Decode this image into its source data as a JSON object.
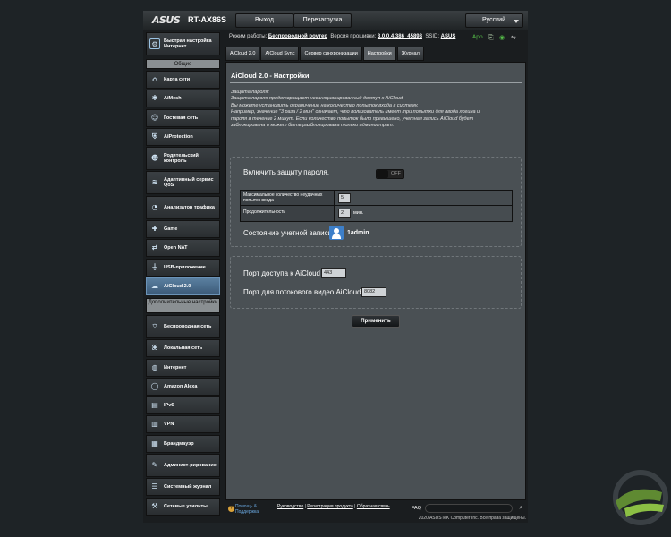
{
  "header": {
    "brand": "ASUS",
    "model": "RT-AX86S",
    "logout_label": "Выход",
    "reboot_label": "Перезагрузка",
    "language": "Русский"
  },
  "status": {
    "mode_label": "Режим работы:",
    "mode_value": "Беспроводной роутер",
    "firmware_label": "Версия прошивки:",
    "firmware_value": "3.0.0.4.386_45898",
    "ssid_label": "SSID:",
    "ssid_value": "ASUS",
    "app_label": "App"
  },
  "sidebar": {
    "quick_setup": "Быстрая настройка Интернет",
    "general_header": "Общие",
    "general_items": [
      {
        "label": "Карта сети",
        "icon": "network-map-icon"
      },
      {
        "label": "AiMesh",
        "icon": "aimesh-icon"
      },
      {
        "label": "Гостевая сеть",
        "icon": "guest-network-icon"
      },
      {
        "label": "AiProtection",
        "icon": "shield-icon"
      },
      {
        "label": "Родительский контроль",
        "icon": "parental-control-icon"
      },
      {
        "label": "Адаптивный сервис QoS",
        "icon": "qos-icon"
      },
      {
        "label": "Анализатор трафика",
        "icon": "traffic-analyzer-icon"
      },
      {
        "label": "Game",
        "icon": "gamepad-icon"
      },
      {
        "label": "Open NAT",
        "icon": "open-nat-icon"
      },
      {
        "label": "USB-приложение",
        "icon": "usb-icon"
      },
      {
        "label": "AiCloud 2.0",
        "icon": "cloud-icon"
      }
    ],
    "advanced_header": "Дополнительные настройки",
    "advanced_items": [
      {
        "label": "Беспроводная сеть",
        "icon": "wireless-icon"
      },
      {
        "label": "Локальная сеть",
        "icon": "lan-icon"
      },
      {
        "label": "Интернет",
        "icon": "globe-icon"
      },
      {
        "label": "Amazon Alexa",
        "icon": "alexa-icon"
      },
      {
        "label": "IPv6",
        "icon": "ipv6-icon"
      },
      {
        "label": "VPN",
        "icon": "vpn-icon"
      },
      {
        "label": "Брандмауэр",
        "icon": "firewall-icon"
      },
      {
        "label": "Админист-рирование",
        "icon": "administration-icon"
      },
      {
        "label": "Системный журнал",
        "icon": "system-log-icon"
      },
      {
        "label": "Сетевые утилиты",
        "icon": "network-tools-icon"
      }
    ]
  },
  "tabs": [
    {
      "label": "AiCloud 2.0"
    },
    {
      "label": "AiCloud Sync"
    },
    {
      "label": "Сервер синхронизации"
    },
    {
      "label": "Настройки"
    },
    {
      "label": "Журнал"
    }
  ],
  "panel": {
    "title": "AiCloud 2.0 - Настройки",
    "description": [
      "Защита пароля:",
      "Защита пароля предотвращает несанкционированный доступ к AiCloud.",
      "Вы можете установить ограничение на количество попыток входа в систему.",
      "Например, значение \"3 раза / 2 мин\" означает, что пользователь имеет три попытки для ввода логина и",
      "пароля в течение 2 минут. Если количество попыток было превышено, учетная запись AiCloud будет",
      "заблокирована и может быть разблокирована только администрат."
    ],
    "protection": {
      "enable_label": "Включить защиту пароля.",
      "toggle_state": "OFF",
      "max_attempts_label": "Максимальное количество неудачных попыток входа",
      "max_attempts_value": "5",
      "duration_label": "Продолжительность",
      "duration_value": "2",
      "duration_unit": "мин.",
      "account_status_label": "Состояние учетной записи",
      "account_user": "1admin"
    },
    "ports": {
      "access_label": "Порт доступа к AiCloud",
      "access_value": "443",
      "stream_label": "Порт для потокового видео AiCloud",
      "stream_value": "8082"
    },
    "apply_label": "Применить"
  },
  "footer": {
    "help_line1": "Помощь &",
    "help_line2": "Поддержка",
    "manual": "Руководство",
    "register": "Регистрация продукта",
    "feedback": "Обратная связь",
    "faq": "FAQ",
    "copyright": "2020 ASUSTeK Computer Inc. Все права защищены."
  }
}
